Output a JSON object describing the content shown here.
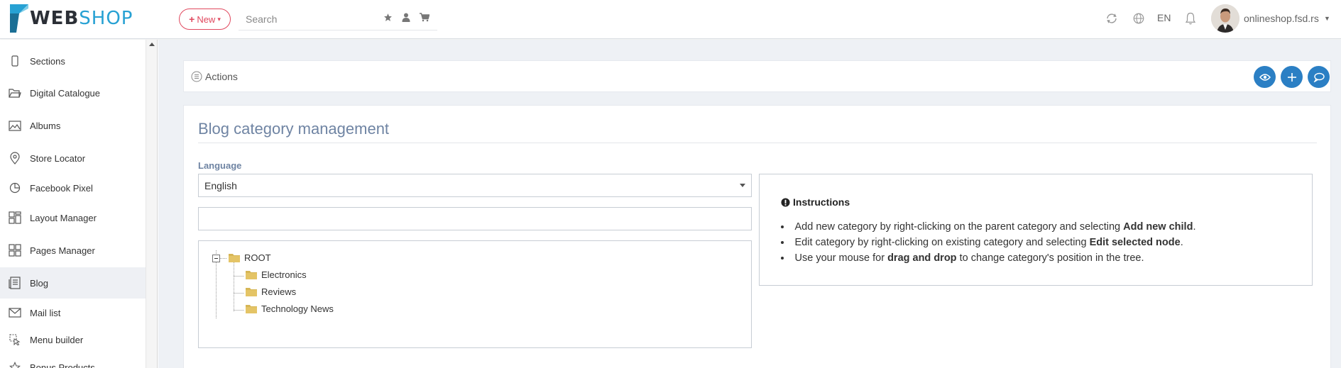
{
  "header": {
    "logo": {
      "word1": "WEB",
      "word2": "SHOP",
      "icon": "webshop-logo-mark"
    },
    "new_button": {
      "label": "New",
      "icon": "plus-icon"
    },
    "search": {
      "placeholder": "Search"
    },
    "quick_icons": [
      "star-icon",
      "user-icon",
      "cart-icon"
    ],
    "right_icons": [
      "refresh-icon",
      "globe-icon"
    ],
    "language_code": "EN",
    "notifications_icon": "bell-icon",
    "user": {
      "name": "onlineshop.fsd.rs"
    }
  },
  "sidebar": {
    "items": [
      {
        "label": "Sections",
        "icon": "mobile-icon",
        "active": false
      },
      {
        "label": "Digital Catalogue",
        "icon": "folder-open-icon",
        "active": false
      },
      {
        "label": "Albums",
        "icon": "image-icon",
        "active": false
      },
      {
        "label": "Store Locator",
        "icon": "map-pin-icon",
        "active": false
      },
      {
        "label": "Facebook Pixel",
        "icon": "pie-chart-icon",
        "active": false
      },
      {
        "label": "Layout Manager",
        "icon": "layout-icon",
        "active": false
      },
      {
        "label": "Pages Manager",
        "icon": "pages-icon",
        "active": false
      },
      {
        "label": "Blog",
        "icon": "blog-icon",
        "active": true
      },
      {
        "label": "Mail list",
        "icon": "envelope-icon",
        "active": false
      },
      {
        "label": "Menu builder",
        "icon": "pointer-icon",
        "active": false
      },
      {
        "label": "Bonus Products",
        "icon": "star-icon",
        "active": false
      }
    ]
  },
  "actions": {
    "label": "Actions",
    "icon": "list-icon",
    "buttons": [
      "eye-icon",
      "plus-icon",
      "comment-icon"
    ]
  },
  "panel": {
    "title": "Blog category management",
    "language_label": "Language",
    "language_value": "English",
    "tree": {
      "root": "ROOT",
      "children": [
        "Electronics",
        "Reviews",
        "Technology News"
      ]
    },
    "instructions": {
      "title": "Instructions",
      "icon": "exclamation-circle-icon",
      "items": [
        {
          "pre": "Add new category by right-clicking on the parent category and selecting ",
          "bold": "Add new child",
          "post": "."
        },
        {
          "pre": "Edit category by right-clicking on existing category and selecting ",
          "bold": "Edit selected node",
          "post": "."
        },
        {
          "pre": "Use your mouse for ",
          "bold": "drag and drop",
          "post": " to change category's position in the tree."
        }
      ]
    }
  },
  "colors": {
    "brand_blue": "#27a1d3",
    "new_button_red": "#e0485e",
    "action_button_blue": "#2b7fc4",
    "title_slate": "#6f84a3",
    "folder_yellow": "#d6b656",
    "main_background": "#eef1f5"
  }
}
